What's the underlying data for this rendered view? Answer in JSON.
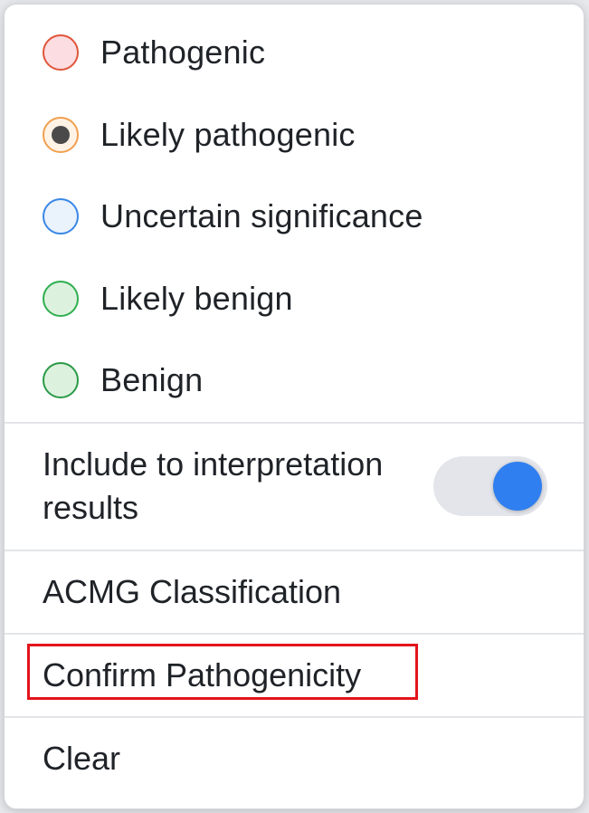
{
  "classification": {
    "options": [
      {
        "label": "Pathogenic",
        "selected": false,
        "fill": "#fbdde2",
        "border": "#e0553a"
      },
      {
        "label": "Likely pathogenic",
        "selected": true,
        "fill": "#fff3e6",
        "border": "#f0a050"
      },
      {
        "label": "Uncertain significance",
        "selected": false,
        "fill": "#eaf2fc",
        "border": "#3a87e6"
      },
      {
        "label": "Likely benign",
        "selected": false,
        "fill": "#ddf2de",
        "border": "#2fae4f"
      },
      {
        "label": "Benign",
        "selected": false,
        "fill": "#ddf2de",
        "border": "#2a9a48"
      }
    ]
  },
  "toggle": {
    "label": "Include to interpretation results",
    "on": true,
    "color": "#2f7ff0"
  },
  "actions": {
    "acmg_label": "ACMG Classification",
    "confirm_label": "Confirm Pathogenicity",
    "clear_label": "Clear"
  },
  "highlight_color": "#e3141c"
}
